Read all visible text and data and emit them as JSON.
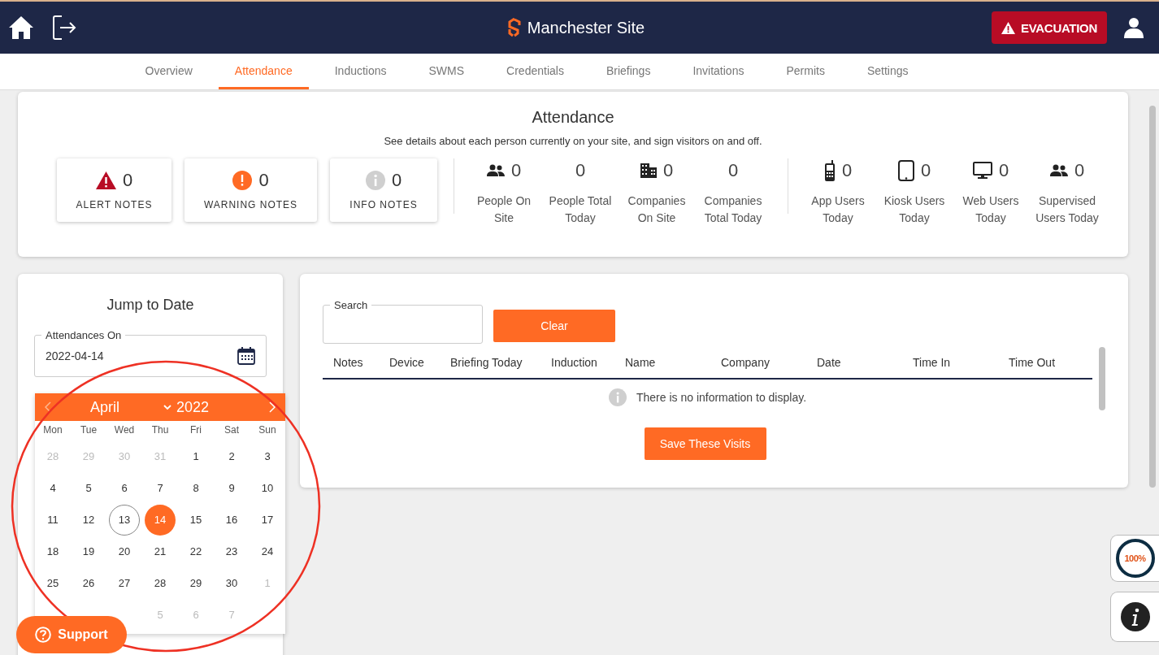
{
  "header": {
    "site_name": "Manchester Site",
    "evacuation_button": "EVACUATION"
  },
  "tabs": [
    {
      "label": "Overview",
      "selected": false
    },
    {
      "label": "Attendance",
      "selected": true
    },
    {
      "label": "Inductions",
      "selected": false
    },
    {
      "label": "SWMS",
      "selected": false
    },
    {
      "label": "Credentials",
      "selected": false
    },
    {
      "label": "Briefings",
      "selected": false
    },
    {
      "label": "Invitations",
      "selected": false
    },
    {
      "label": "Permits",
      "selected": false
    },
    {
      "label": "Settings",
      "selected": false
    }
  ],
  "summary": {
    "title": "Attendance",
    "subtitle": "See details about each person currently on your site, and sign visitors on and off.",
    "notes": [
      {
        "kind": "alert",
        "count": "0",
        "label": "ALERT NOTES"
      },
      {
        "kind": "warning",
        "count": "0",
        "label": "WARNING NOTES"
      },
      {
        "kind": "info",
        "count": "0",
        "label": "INFO NOTES"
      }
    ],
    "counter_groups": [
      [
        {
          "value": "0",
          "label_lines": [
            "People On",
            "Site"
          ]
        },
        {
          "value": "0",
          "label_lines": [
            "People Total",
            "Today"
          ]
        },
        {
          "value": "0",
          "label_lines": [
            "Companies",
            "On Site"
          ]
        },
        {
          "value": "0",
          "label_lines": [
            "Companies",
            "Total Today"
          ]
        }
      ],
      [
        {
          "value": "0",
          "label_lines": [
            "App Users",
            "Today"
          ]
        },
        {
          "value": "0",
          "label_lines": [
            "Kiosk Users",
            "Today"
          ]
        },
        {
          "value": "0",
          "label_lines": [
            "Web Users",
            "Today"
          ]
        },
        {
          "value": "0",
          "label_lines": [
            "Supervised",
            "Users Today"
          ]
        }
      ]
    ]
  },
  "jump_to_date": {
    "title": "Jump to Date",
    "field_label": "Attendances On",
    "field_value": "2022-04-14"
  },
  "calendar": {
    "month": "April",
    "year": "2022",
    "weekdays": [
      "Mon",
      "Tue",
      "Wed",
      "Thu",
      "Fri",
      "Sat",
      "Sun"
    ],
    "weeks": [
      [
        {
          "day": "28",
          "muted": true,
          "today": false,
          "selected": false
        },
        {
          "day": "29",
          "muted": true,
          "today": false,
          "selected": false
        },
        {
          "day": "30",
          "muted": true,
          "today": false,
          "selected": false
        },
        {
          "day": "31",
          "muted": true,
          "today": false,
          "selected": false
        },
        {
          "day": "1",
          "muted": false,
          "today": false,
          "selected": false
        },
        {
          "day": "2",
          "muted": false,
          "today": false,
          "selected": false
        },
        {
          "day": "3",
          "muted": false,
          "today": false,
          "selected": false
        }
      ],
      [
        {
          "day": "4",
          "muted": false,
          "today": false,
          "selected": false
        },
        {
          "day": "5",
          "muted": false,
          "today": false,
          "selected": false
        },
        {
          "day": "6",
          "muted": false,
          "today": false,
          "selected": false
        },
        {
          "day": "7",
          "muted": false,
          "today": false,
          "selected": false
        },
        {
          "day": "8",
          "muted": false,
          "today": false,
          "selected": false
        },
        {
          "day": "9",
          "muted": false,
          "today": false,
          "selected": false
        },
        {
          "day": "10",
          "muted": false,
          "today": false,
          "selected": false
        }
      ],
      [
        {
          "day": "11",
          "muted": false,
          "today": false,
          "selected": false
        },
        {
          "day": "12",
          "muted": false,
          "today": false,
          "selected": false
        },
        {
          "day": "13",
          "muted": false,
          "today": true,
          "selected": false
        },
        {
          "day": "14",
          "muted": false,
          "today": false,
          "selected": true
        },
        {
          "day": "15",
          "muted": false,
          "today": false,
          "selected": false
        },
        {
          "day": "16",
          "muted": false,
          "today": false,
          "selected": false
        },
        {
          "day": "17",
          "muted": false,
          "today": false,
          "selected": false
        }
      ],
      [
        {
          "day": "18",
          "muted": false,
          "today": false,
          "selected": false
        },
        {
          "day": "19",
          "muted": false,
          "today": false,
          "selected": false
        },
        {
          "day": "20",
          "muted": false,
          "today": false,
          "selected": false
        },
        {
          "day": "21",
          "muted": false,
          "today": false,
          "selected": false
        },
        {
          "day": "22",
          "muted": false,
          "today": false,
          "selected": false
        },
        {
          "day": "23",
          "muted": false,
          "today": false,
          "selected": false
        },
        {
          "day": "24",
          "muted": false,
          "today": false,
          "selected": false
        }
      ],
      [
        {
          "day": "25",
          "muted": false,
          "today": false,
          "selected": false
        },
        {
          "day": "26",
          "muted": false,
          "today": false,
          "selected": false
        },
        {
          "day": "27",
          "muted": false,
          "today": false,
          "selected": false
        },
        {
          "day": "28",
          "muted": false,
          "today": false,
          "selected": false
        },
        {
          "day": "29",
          "muted": false,
          "today": false,
          "selected": false
        },
        {
          "day": "30",
          "muted": false,
          "today": false,
          "selected": false
        },
        {
          "day": "1",
          "muted": true,
          "today": false,
          "selected": false
        }
      ],
      [
        {
          "day": "5",
          "muted": true,
          "today": false,
          "selected": false
        },
        {
          "day": "6",
          "muted": true,
          "today": false,
          "selected": false
        },
        {
          "day": "7",
          "muted": true,
          "today": false,
          "selected": false
        }
      ]
    ]
  },
  "visits": {
    "search_label": "Search",
    "clear_button": "Clear",
    "columns": [
      "Notes",
      "Device",
      "Briefing Today",
      "Induction",
      "Name",
      "Company",
      "Date",
      "Time In",
      "Time Out"
    ],
    "empty_message": "There is no information to display.",
    "save_button": "Save These Visits"
  },
  "support_button": "Support",
  "progress_widget": {
    "label": "100%",
    "level": 1
  }
}
